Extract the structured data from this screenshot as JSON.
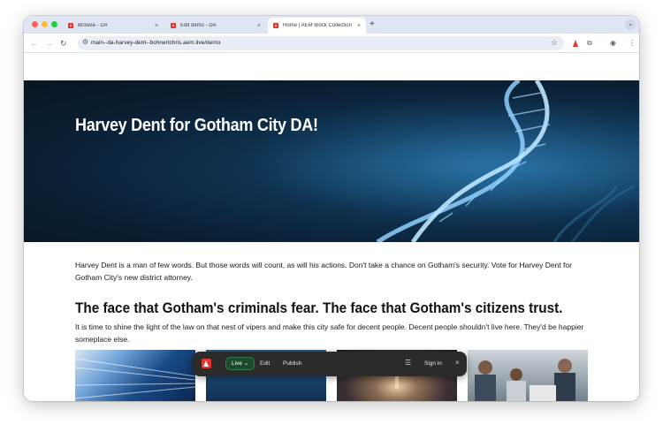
{
  "browser": {
    "tabs": [
      {
        "label": "Browse - DA",
        "active": false
      },
      {
        "label": "Edit demo - DA",
        "active": false
      },
      {
        "label": "Home | AEM Block Collection",
        "active": true
      }
    ],
    "new_tab_symbol": "+",
    "tab_close_symbol": "×",
    "tab_search_symbol": "⌄",
    "url": "main--da-harvey-dent--bohnertchris.aem.live/demo",
    "icons": {
      "back": "arrow-left-icon",
      "forward": "arrow-right-icon",
      "reload": "reload-icon",
      "site_info": "tune-icon",
      "bookmark": "star-icon",
      "extensions": "puzzle-icon",
      "profile": "profile-icon",
      "menu": "kebab-menu-icon"
    }
  },
  "hero": {
    "title": "Harvey Dent for Gotham City DA!"
  },
  "content": {
    "intro": "Harvey Dent is a man of few words. But those words will count, as will his actions. Don't take a chance on Gotham's security. Vote for Harvey Dent for Gotham City's new district attorney.",
    "heading": "The face that Gotham's criminals fear. The face that Gotham's citizens trust.",
    "body": "It is time to shine the light of the law on that nest of vipers and make this city safe for decent people. Decent people shouldn't live here. They'd be happier someplace else."
  },
  "da_toolbar": {
    "live_label": "Live",
    "edit_label": "Edit",
    "publish_label": "Publish",
    "signin_label": "Sign in",
    "close_symbol": "×",
    "menu_symbol": "☰"
  },
  "colors": {
    "hero_bg": "#0a1f33",
    "adobe_red": "#e8352b",
    "toolbar_bg": "#2b2b2b",
    "live_green": "#1c4a2e"
  }
}
